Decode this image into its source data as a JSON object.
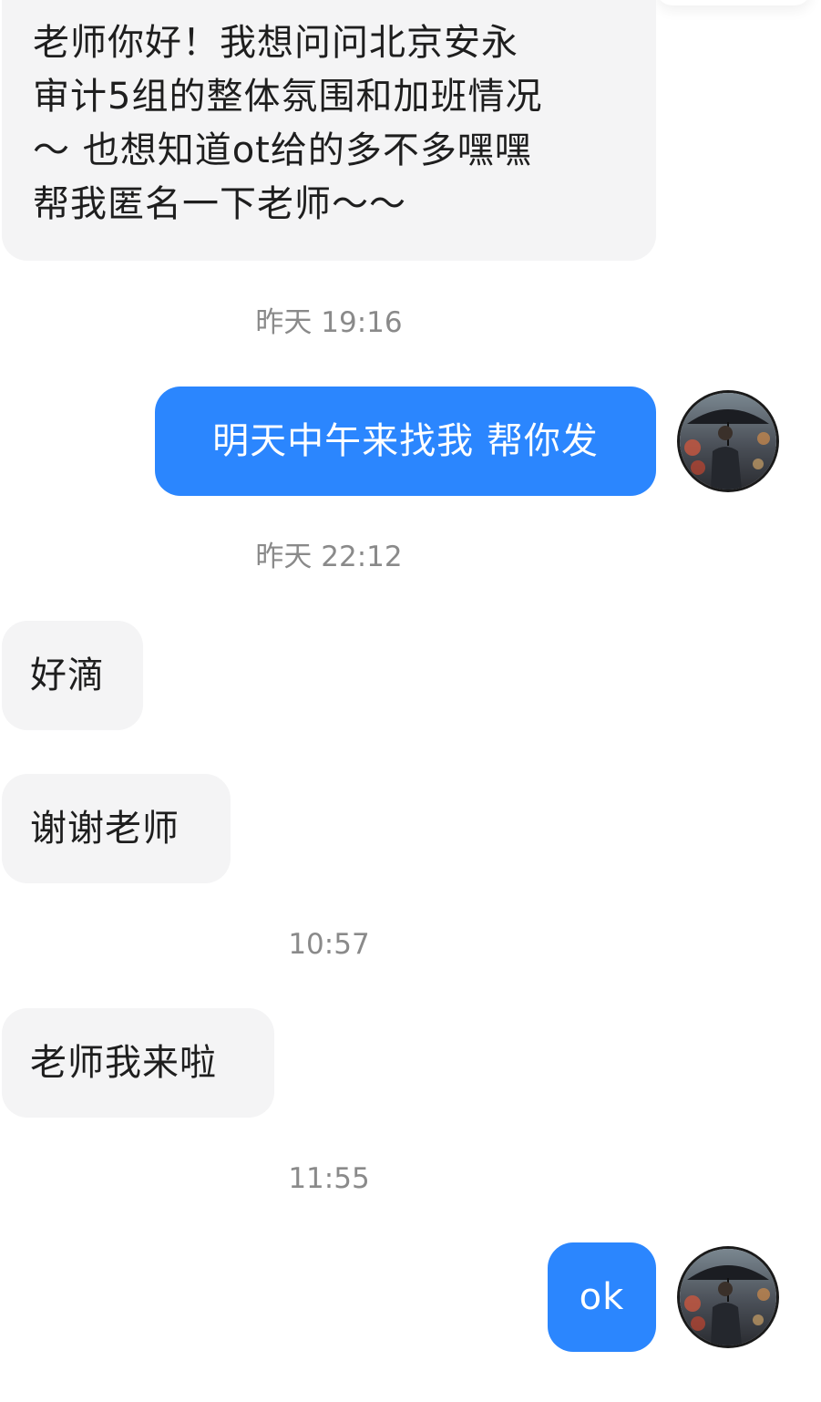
{
  "messages": [
    {
      "id": "m1",
      "direction": "incoming",
      "text_lines": [
        "老师你好！我想问问北京安永",
        "审计5组的整体氛围和加班情况",
        "～ 也想知道ot给的多不多嘿嘿",
        "帮我匿名一下老师～～"
      ]
    },
    {
      "id": "t1",
      "type": "timestamp",
      "text": "昨天 19:16"
    },
    {
      "id": "m2",
      "direction": "outgoing",
      "text": "明天中午来找我 帮你发",
      "avatar_icon": "person-with-umbrella-avatar"
    },
    {
      "id": "t2",
      "type": "timestamp",
      "text": "昨天 22:12"
    },
    {
      "id": "m3",
      "direction": "incoming",
      "text": "好滴"
    },
    {
      "id": "m4",
      "direction": "incoming",
      "text": "谢谢老师"
    },
    {
      "id": "t3",
      "type": "timestamp",
      "text": "10:57"
    },
    {
      "id": "m5",
      "direction": "incoming",
      "text": "老师我来啦"
    },
    {
      "id": "t4",
      "type": "timestamp",
      "text": "11:55"
    },
    {
      "id": "m6",
      "direction": "outgoing",
      "text": "ok",
      "avatar_icon": "person-with-umbrella-avatar"
    }
  ],
  "colors": {
    "incoming_bubble": "#f4f4f5",
    "outgoing_bubble": "#2b86fe",
    "timestamp_text": "#8a8a8a"
  }
}
